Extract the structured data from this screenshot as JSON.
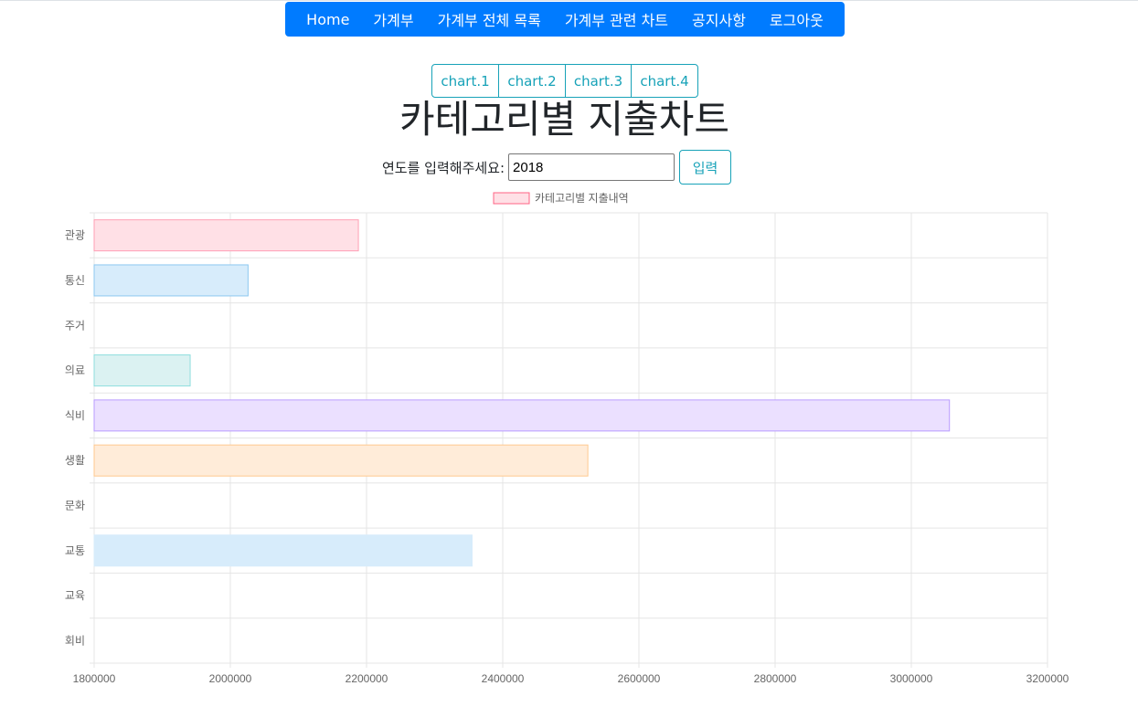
{
  "nav": {
    "items": [
      "Home",
      "가계부",
      "가계부 전체 목록",
      "가계부 관련 차트",
      "공지사항",
      "로그아웃"
    ]
  },
  "chart_tabs": [
    "chart.1",
    "chart.2",
    "chart.3",
    "chart.4"
  ],
  "page_title": "카테고리별 지출차트",
  "year_form": {
    "label": "연도를 입력해주세요:",
    "value": "2018",
    "submit_label": "입력"
  },
  "colors": {
    "primary": "#007bff",
    "info": "#17a2b8"
  },
  "chart_data": {
    "type": "bar",
    "orientation": "horizontal",
    "categories": [
      "관광",
      "통신",
      "주거",
      "의료",
      "식비",
      "생활",
      "문화",
      "교통",
      "교육",
      "회비"
    ],
    "series": [
      {
        "name": "카테고리별 지출내역",
        "values": [
          2188000,
          2026000,
          null,
          1941000,
          3056000,
          2525000,
          null,
          2355000,
          null,
          null
        ]
      }
    ],
    "bar_fills": [
      "#ffe0e6",
      "#d7ecfb",
      "#ffffff",
      "#dbf2f2",
      "#ebe0ff",
      "#ffecd9",
      "#ffffff",
      "#d7ecfb",
      "#ffffff",
      "#ffffff"
    ],
    "bar_strokes": [
      "#ff9fb4",
      "#8cc8f0",
      "#ffffff",
      "#8fdede",
      "#b99bff",
      "#ffc98f",
      "#ffffff",
      "#d7ecfb",
      "#ffffff",
      "#ffffff"
    ],
    "legend_fill": "#ffe0e6",
    "legend_stroke": "#ff6384",
    "xlim": [
      1800000,
      3200000
    ],
    "xticks": [
      "1800000",
      "2000000",
      "2200000",
      "2400000",
      "2600000",
      "2800000",
      "3000000",
      "3200000"
    ],
    "legend_position": "top",
    "grid": true
  }
}
